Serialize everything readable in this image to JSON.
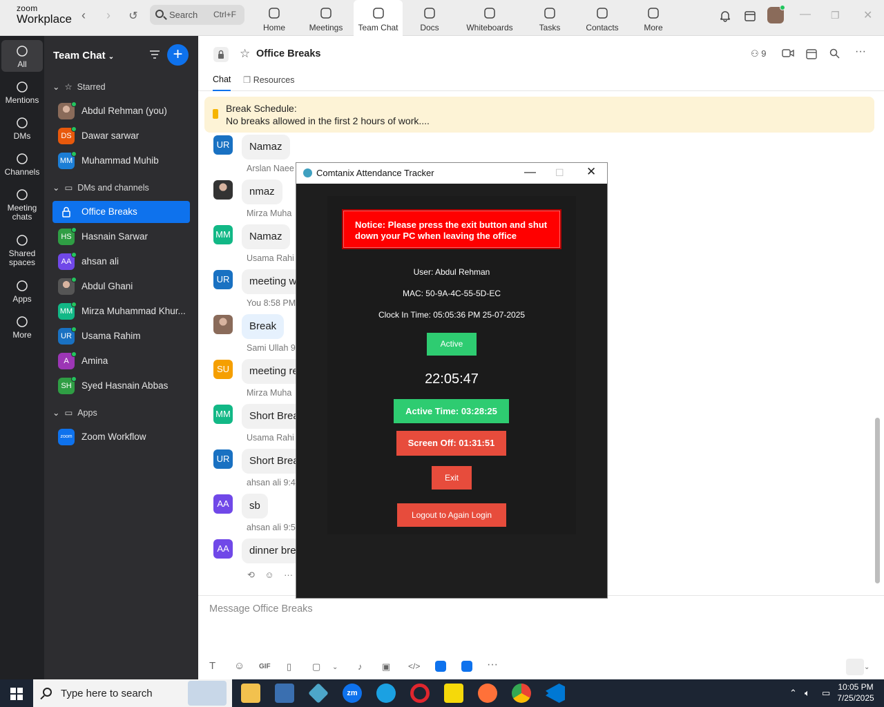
{
  "app": {
    "logo_top": "zoom",
    "logo_bottom": "Workplace"
  },
  "search": {
    "label": "Search",
    "shortcut": "Ctrl+F"
  },
  "nav_tabs": [
    {
      "label": "Home",
      "icon": "home-icon"
    },
    {
      "label": "Meetings",
      "icon": "video-icon"
    },
    {
      "label": "Team Chat",
      "icon": "chat-icon"
    },
    {
      "label": "Docs",
      "icon": "doc-icon"
    },
    {
      "label": "Whiteboards",
      "icon": "whiteboard-icon"
    },
    {
      "label": "Tasks",
      "icon": "tasks-icon"
    },
    {
      "label": "Contacts",
      "icon": "contacts-icon"
    },
    {
      "label": "More",
      "icon": "more-icon"
    }
  ],
  "active_nav_tab": "Team Chat",
  "rail": [
    {
      "label": "All",
      "icon": "chat-bubble-icon"
    },
    {
      "label": "Mentions",
      "icon": "at-icon"
    },
    {
      "label": "DMs",
      "icon": "people-icon"
    },
    {
      "label": "Channels",
      "icon": "hash-icon"
    },
    {
      "label": "Meeting chats",
      "icon": "calendar-icon"
    },
    {
      "label": "Shared spaces",
      "icon": "share-icon"
    },
    {
      "label": "Apps",
      "icon": "apps-icon"
    },
    {
      "label": "More",
      "icon": "more-icon"
    }
  ],
  "sidebar": {
    "title": "Team Chat",
    "sections": {
      "starred": "Starred",
      "dms": "DMs and channels",
      "apps": "Apps"
    },
    "starred": [
      {
        "name": "Abdul Rehman (you)",
        "initials": "",
        "color": "#8a6b5a",
        "photo": true
      },
      {
        "name": "Dawar sarwar",
        "initials": "DS",
        "color": "#e8590c"
      },
      {
        "name": "Muhammad Muhib",
        "initials": "MM",
        "color": "#1c7ed6"
      }
    ],
    "dms": [
      {
        "name": "Office Breaks",
        "initials": "",
        "color": "",
        "lock": true
      },
      {
        "name": "Hasnain Sarwar",
        "initials": "HS",
        "color": "#2f9e44"
      },
      {
        "name": "ahsan ali",
        "initials": "AA",
        "color": "#7048e8"
      },
      {
        "name": "Abdul Ghani",
        "initials": "",
        "color": "#555",
        "photo": true
      },
      {
        "name": "Mirza Muhammad Khur...",
        "initials": "MM",
        "color": "#12b886"
      },
      {
        "name": "Usama Rahim",
        "initials": "UR",
        "color": "#1971c2"
      },
      {
        "name": "Amina",
        "initials": "A",
        "color": "#9c36b5"
      },
      {
        "name": "Syed Hasnain Abbas",
        "initials": "SH",
        "color": "#2f9e44"
      }
    ],
    "apps": [
      {
        "name": "Zoom Workflow",
        "initials": "zoom",
        "color": "#0e72ed"
      }
    ]
  },
  "chat": {
    "title": "Office Breaks",
    "member_count": "9",
    "tabs": [
      "Chat",
      "Resources"
    ],
    "pinned_title": "Break Schedule:",
    "pinned_text": "No breaks allowed in the first 2 hours of work....",
    "messages": [
      {
        "sender": "",
        "initials": "UR",
        "color": "#1971c2",
        "text": "Namaz",
        "mine": false
      },
      {
        "sender": "Arslan Naee",
        "initials": "",
        "color": "#333",
        "text": "nmaz",
        "mine": false,
        "photo": true
      },
      {
        "sender": "Mirza Muha",
        "initials": "MM",
        "color": "#12b886",
        "text": "Namaz",
        "mine": false
      },
      {
        "sender": "Usama Rahi",
        "initials": "UR",
        "color": "#1971c2",
        "text": "meeting w",
        "mine": false
      },
      {
        "sender": "You 8:58 PM",
        "initials": "",
        "color": "#8a6b5a",
        "text": "Break",
        "mine": true,
        "photo": true
      },
      {
        "sender": "Sami Ullah 9",
        "initials": "SU",
        "color": "#f59f00",
        "text": "meeting re",
        "mine": false
      },
      {
        "sender": "Mirza Muha",
        "initials": "MM",
        "color": "#12b886",
        "text": "Short Brea",
        "mine": false
      },
      {
        "sender": "Usama Rahi",
        "initials": "UR",
        "color": "#1971c2",
        "text": "Short Brea",
        "mine": false
      },
      {
        "sender": "ahsan ali 9:4",
        "initials": "AA",
        "color": "#7048e8",
        "text": "sb",
        "mine": false
      },
      {
        "sender": "ahsan ali 9:5",
        "initials": "AA",
        "color": "#7048e8",
        "text": "dinner bre",
        "mine": false
      }
    ],
    "composer_placeholder": "Message Office Breaks"
  },
  "attendance": {
    "window_title": "Comtanix Attendance Tracker",
    "notice": "Notice: Please press the exit button and shut down your PC when leaving the office",
    "user": "User: Abdul Rehman",
    "mac": "MAC: 50-9A-4C-55-5D-EC",
    "clock_in": "Clock In Time: 05:05:36 PM 25-07-2025",
    "status": "Active",
    "clock": "22:05:47",
    "active_time": "Active Time: 03:28:25",
    "screen_off": "Screen Off: 01:31:51",
    "exit": "Exit",
    "logout": "Logout to Again Login",
    "colors": {
      "green": "#2ecc71",
      "red": "#e74c3c",
      "notice": "#ff0000"
    }
  },
  "taskbar": {
    "search_placeholder": "Type here to search",
    "time": "10:05 PM",
    "date": "7/25/2025"
  },
  "colors": {
    "accent": "#0e72ed",
    "sidebar": "#2d2d30",
    "rail": "#202124"
  }
}
